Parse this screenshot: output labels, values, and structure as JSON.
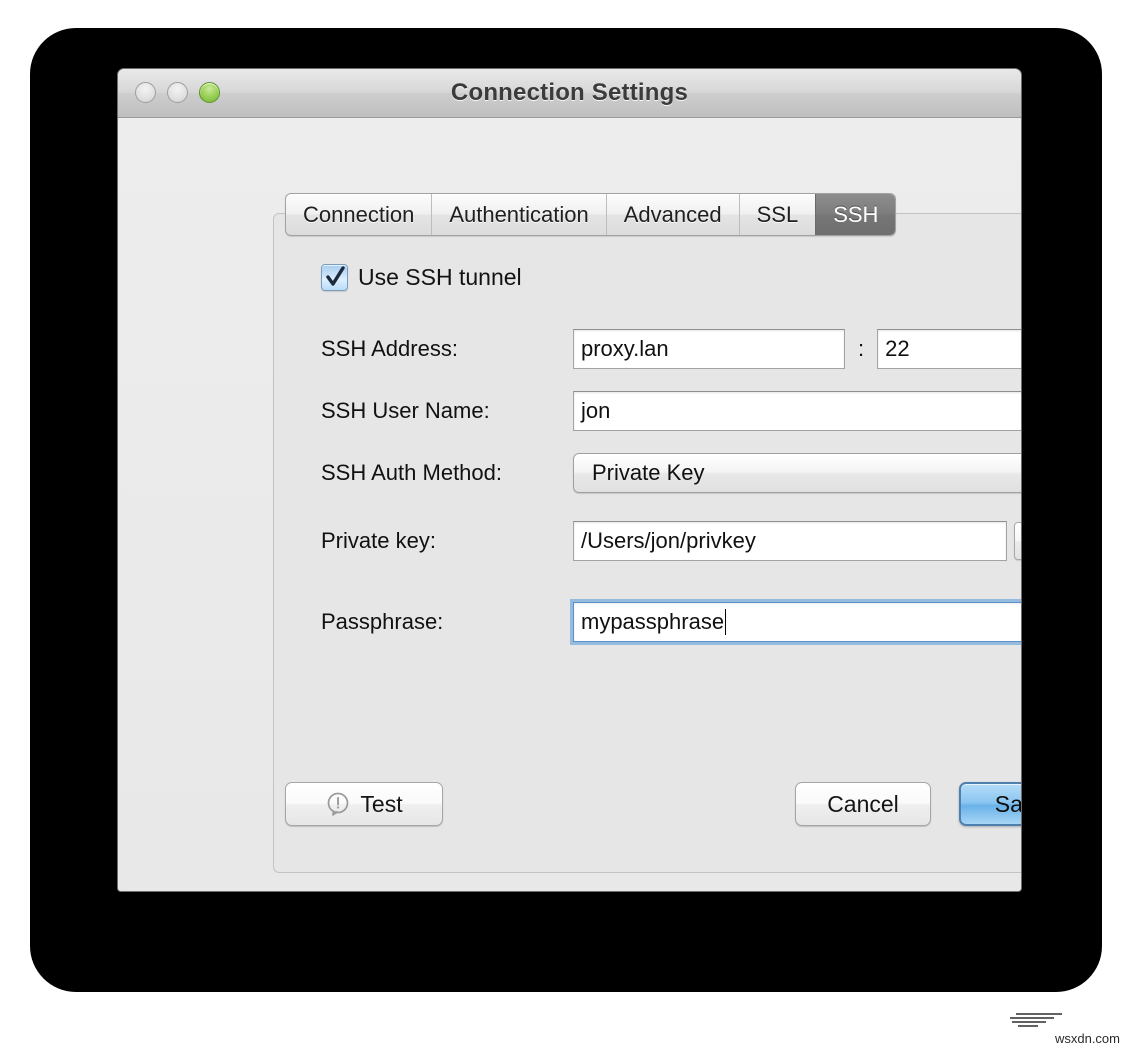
{
  "window": {
    "title": "Connection Settings",
    "traffic_lights": [
      {
        "name": "close-button",
        "state": "disabled"
      },
      {
        "name": "minimize-button",
        "state": "disabled"
      },
      {
        "name": "zoom-button",
        "state": "enabled",
        "color": "#9fd35c"
      }
    ]
  },
  "tabs": [
    {
      "label": "Connection",
      "selected": false
    },
    {
      "label": "Authentication",
      "selected": false
    },
    {
      "label": "Advanced",
      "selected": false
    },
    {
      "label": "SSL",
      "selected": false
    },
    {
      "label": "SSH",
      "selected": true
    }
  ],
  "ssh": {
    "use_tunnel": {
      "label": "Use SSH tunnel",
      "checked": true
    },
    "address": {
      "label": "SSH Address:",
      "host_value": "proxy.lan",
      "separator": ":",
      "port_value": "22"
    },
    "user_name": {
      "label": "SSH User Name:",
      "value": "jon"
    },
    "auth_method": {
      "label": "SSH Auth Method:",
      "value": "Private Key"
    },
    "private_key": {
      "label": "Private key:",
      "value": "/Users/jon/privkey",
      "browse_label": "..."
    },
    "passphrase": {
      "label": "Passphrase:",
      "value": "mypassphrase",
      "focused": true
    }
  },
  "buttons": {
    "test": "Test",
    "cancel": "Cancel",
    "save": "Save"
  },
  "icons": {
    "test": "exclamation-bubble-icon",
    "checkbox": "checkmark-icon",
    "stepper": "updown-arrows-icon"
  },
  "watermark": {
    "text": "wsxdn.com"
  },
  "colors": {
    "accent_blue": "#6ab2e9",
    "selected_tab": "#7d7d7d",
    "panel_bg": "#e6e6e6",
    "focus_ring": "#61a2dd"
  }
}
